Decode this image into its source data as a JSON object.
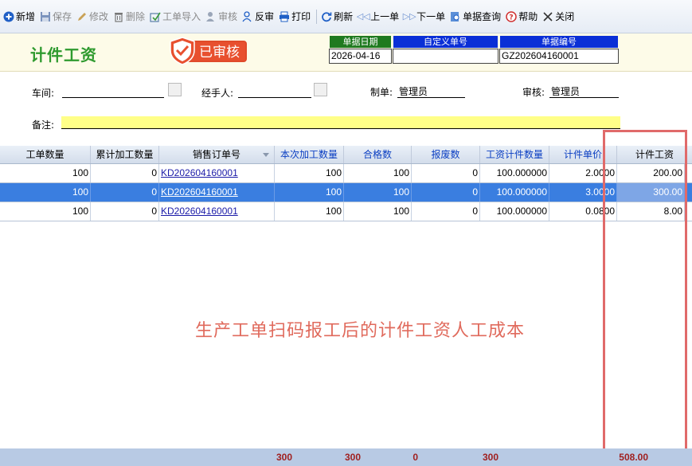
{
  "toolbar": {
    "new": "新增",
    "save": "保存",
    "edit": "修改",
    "delete": "删除",
    "import": "工单导入",
    "audit": "审核",
    "unaudit": "反审",
    "print": "打印",
    "refresh": "刷新",
    "prev": "上一单",
    "next": "下一单",
    "query": "单据查询",
    "help": "帮助",
    "close": "关闭"
  },
  "header": {
    "title": "计件工资",
    "stamp": "已审核",
    "date_label": "单据日期",
    "date_value": "2026-04-16",
    "custom_label": "自定义单号",
    "custom_value": "",
    "docno_label": "单据编号",
    "docno_value": "GZ202604160001"
  },
  "form": {
    "workshop_label": "车间:",
    "workshop_value": "",
    "handler_label": "经手人:",
    "handler_value": "",
    "maker_label": "制单:",
    "maker_value": "管理员",
    "auditor_label": "审核:",
    "auditor_value": "管理员",
    "remark_label": "备注:",
    "remark_value": ""
  },
  "grid": {
    "columns": [
      "工单数量",
      "累计加工数量",
      "销售订单号",
      "本次加工数量",
      "合格数",
      "报废数",
      "工资计件数量",
      "计件单价",
      "计件工资"
    ],
    "rows": [
      {
        "qty": "100",
        "cum": "0",
        "order": "KD202604160001",
        "cur": "100",
        "pass": "100",
        "scrap": "0",
        "pieces": "100.000000",
        "price": "2.0000",
        "wage": "200.00"
      },
      {
        "qty": "100",
        "cum": "0",
        "order": "KD202604160001",
        "cur": "100",
        "pass": "100",
        "scrap": "0",
        "pieces": "100.000000",
        "price": "3.0000",
        "wage": "300.00"
      },
      {
        "qty": "100",
        "cum": "0",
        "order": "KD202604160001",
        "cur": "100",
        "pass": "100",
        "scrap": "0",
        "pieces": "100.000000",
        "price": "0.0800",
        "wage": "8.00"
      }
    ],
    "selected_row": 1
  },
  "annotation": "生产工单扫码报工后的计件工资人工成本",
  "totals": {
    "cur": "300",
    "pass": "300",
    "scrap": "0",
    "pieces": "300",
    "wage": "508.00"
  },
  "colors": {
    "title_green": "#2e9a2e",
    "stamp_red": "#e8502f",
    "header_label_green": "#1f7a1f",
    "header_label_blue": "#0a2fd6",
    "selected_row": "#3a7ee0",
    "annotation_red": "#e06a5c",
    "total_text": "#a02020",
    "remark_yellow": "#ffff88"
  },
  "icons": [
    "plus-circle-icon",
    "floppy-icon",
    "pencil-icon",
    "trash-icon",
    "import-icon",
    "user-check-icon",
    "user-undo-icon",
    "printer-icon",
    "refresh-icon",
    "double-left-arrow-icon",
    "double-right-arrow-icon",
    "search-doc-icon",
    "help-icon",
    "close-x-icon",
    "shield-check-icon"
  ]
}
